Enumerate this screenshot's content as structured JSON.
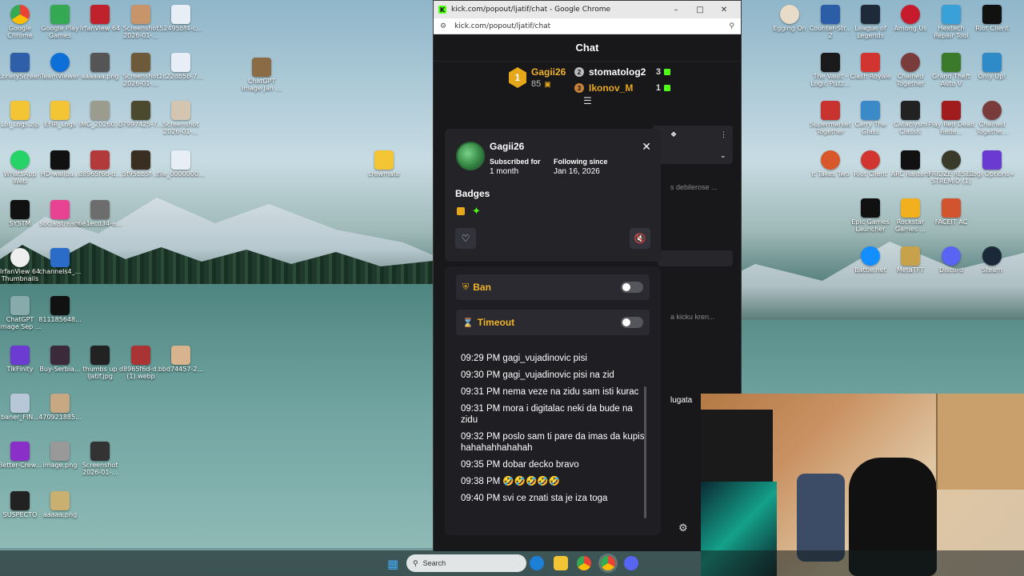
{
  "window": {
    "title": "kick.com/popout/ljatif/chat - Google Chrome",
    "url": "kick.com/popout/ljatif/chat"
  },
  "chat": {
    "header": "Chat",
    "leaderboard": {
      "first": {
        "rank": "1",
        "name": "Gagii26",
        "count": "85"
      },
      "second": {
        "rank": "2",
        "name": "stomatolog2",
        "count": "3"
      },
      "third": {
        "rank": "3",
        "name": "Ikonov_M",
        "count": "1"
      }
    },
    "background_snippets": [
      "s debilerose ...",
      "a kicku kren...",
      "lugata"
    ]
  },
  "user_card": {
    "username": "Gagii26",
    "subscribed_label": "Subscribed for",
    "subscribed_value": "1 month",
    "following_label": "Following since",
    "following_value": "Jan 16, 2026",
    "badges_title": "Badges"
  },
  "moderation": {
    "ban_label": "Ban",
    "timeout_label": "Timeout",
    "ban_enabled": false,
    "timeout_enabled": false,
    "messages": [
      "09:29 PM gagi_vujadinovic pisi",
      "09:30 PM gagi_vujadinovic pisi na zid",
      "09:31 PM nema veze na zidu sam isti kurac",
      "09:31 PM mora i digitalac neki da bude na zidu",
      "09:32 PM poslo sam ti pare da imas da kupis hahahahhahahah",
      "09:35 PM dobar decko bravo",
      "09:38 PM 🤣🤣🤣🤣🤣",
      "09:40 PM svi ce znati sta je iza toga"
    ]
  },
  "desktop_icons": {
    "left": [
      "Google Chrome",
      "Google Play Games",
      "IrfanView 64",
      "Screenshot 2026-01-...",
      "52495bf4-c...",
      "LonelyScreen",
      "TeamViewer",
      "aaaaaa.png",
      "Screenshot 2026-01-...",
      "1c22db5b-7...",
      "Lol_Logs.zip",
      "EFIR_Logs",
      "IMG_20260...",
      "07997425-7...",
      "Screenshot 2026-01-...",
      "WhatsApp Web",
      "HD-wallpa...",
      "d8965f6d-d...",
      "5f95bb5f-...",
      "file_0000000...",
      "SYSTM",
      "socialstream",
      "6e1ecd34-e...",
      "IrfanView 64 Thumbnails",
      "channels4_...",
      "ChatGPT Image Sep ...",
      "811185648...",
      "TikFinity",
      "Buy-Serbia...",
      "thumbs up ljatif.jpg",
      "d8965f6d-d... (1).webp",
      "bbd74457-2...",
      "baner_FIN...",
      "470921885...",
      "Better-Crew...",
      "image.png",
      "Screenshot 2026-01-...",
      "SUSPECTO",
      "aaaaa.png"
    ],
    "middle": [
      "ChatGPT Image Jan ...",
      "crewmate"
    ],
    "right": [
      "Egging On",
      "Counter-Str... 2",
      "League of Legends",
      "Among Us",
      "Hextech Repair Tool",
      "Riot Client",
      "The Vault - Logic Puzz...",
      "Clash Royale",
      "Chained Together",
      "Grand Theft Auto V",
      "Only Up!",
      "Supermarket Together",
      "Carry The Glass",
      "Cataclysm Classic",
      "Play Red Dead Rede...",
      "Chained Togethe...",
      "It Takes Two",
      "Riot Client",
      "ARC Raiders",
      "FRIDZE RESET STREMIO (1)",
      "Logi Options+",
      "Epic Games Launcher",
      "Rockstar Games ...",
      "FACEIT AC",
      "Battle.net",
      "MetaTFT",
      "Discord",
      "Steam"
    ]
  },
  "taskbar": {
    "search_placeholder": "Search"
  },
  "colors": {
    "kick_green": "#53fc18",
    "gold": "#f0b429",
    "chat_bg": "#18181b"
  }
}
